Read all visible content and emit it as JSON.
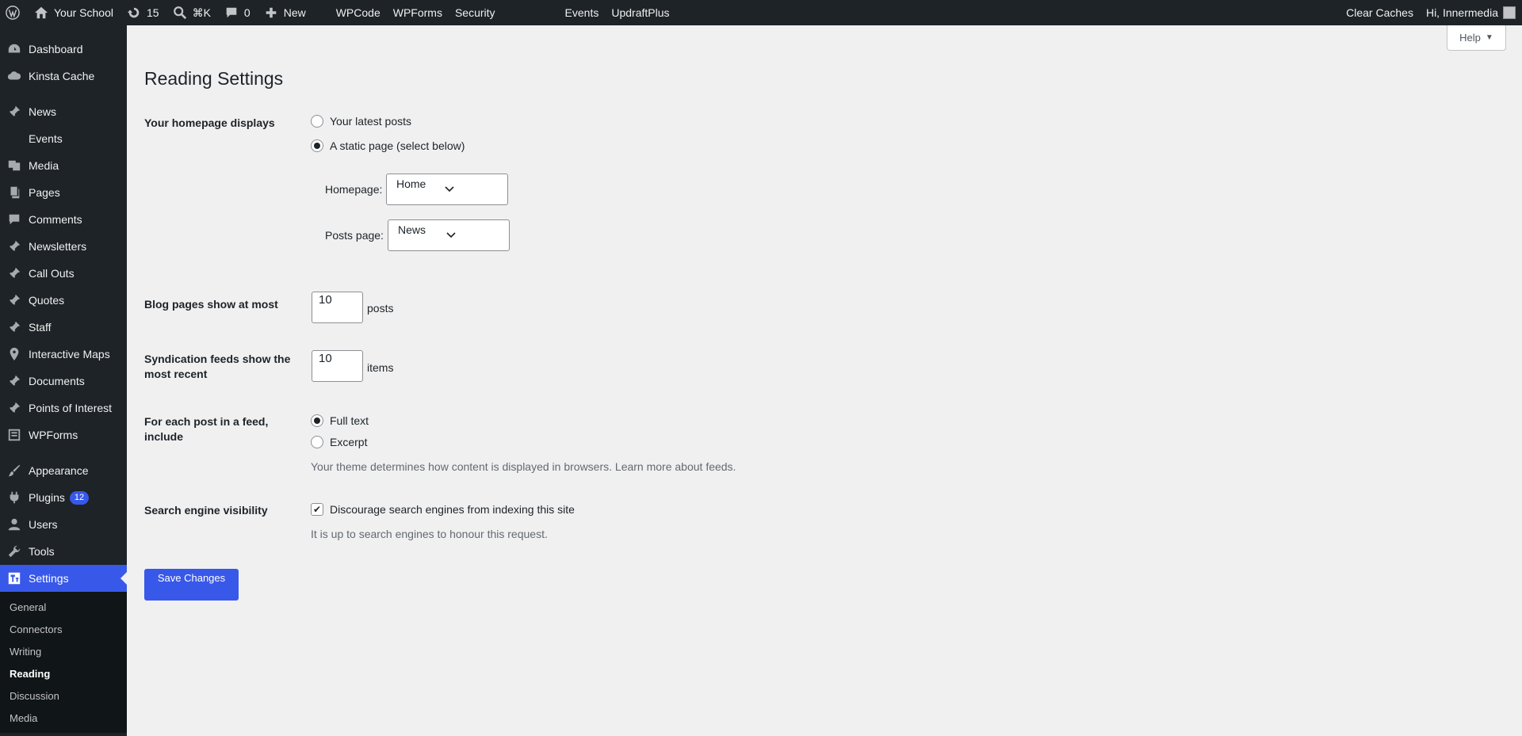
{
  "adminbar": {
    "site_name": "Your School",
    "updates_count": "15",
    "search_shortcut": "⌘K",
    "comments_count": "0",
    "new_label": "New",
    "links": [
      "WPCode",
      "WPForms",
      "Security",
      "Events",
      "UpdraftPlus"
    ],
    "clear_caches": "Clear Caches",
    "greeting": "Hi, Innermedia"
  },
  "sidebar": {
    "items": [
      {
        "label": "Dashboard",
        "icon": "dashboard-icon"
      },
      {
        "label": "Kinsta Cache",
        "icon": "cloud-icon"
      },
      {
        "label": "News",
        "icon": "pin-icon"
      },
      {
        "label": "Events",
        "icon": "blank-icon"
      },
      {
        "label": "Media",
        "icon": "media-icon"
      },
      {
        "label": "Pages",
        "icon": "pages-icon"
      },
      {
        "label": "Comments",
        "icon": "comment-icon"
      },
      {
        "label": "Newsletters",
        "icon": "pin-icon"
      },
      {
        "label": "Call Outs",
        "icon": "pin-icon"
      },
      {
        "label": "Quotes",
        "icon": "pin-icon"
      },
      {
        "label": "Staff",
        "icon": "pin-icon"
      },
      {
        "label": "Interactive Maps",
        "icon": "location-icon"
      },
      {
        "label": "Documents",
        "icon": "pin-icon"
      },
      {
        "label": "Points of Interest",
        "icon": "pin-icon"
      },
      {
        "label": "WPForms",
        "icon": "forms-icon"
      },
      {
        "label": "Appearance",
        "icon": "brush-icon"
      },
      {
        "label": "Plugins",
        "icon": "plugin-icon",
        "badge": "12"
      },
      {
        "label": "Users",
        "icon": "user-icon"
      },
      {
        "label": "Tools",
        "icon": "wrench-icon"
      },
      {
        "label": "Settings",
        "icon": "settings-icon"
      }
    ],
    "submenu": [
      "General",
      "Connectors",
      "Writing",
      "Reading",
      "Discussion",
      "Media"
    ]
  },
  "help": {
    "label": "Help",
    "caret": "▼"
  },
  "page": {
    "title": "Reading Settings",
    "homepage_displays": {
      "label": "Your homepage displays",
      "option_latest": "Your latest posts",
      "option_static": "A static page (select below)",
      "selected": "A static page (select below)",
      "homepage_label": "Homepage:",
      "homepage_value": "Home",
      "posts_page_label": "Posts page:",
      "posts_page_value": "News"
    },
    "blog_pages": {
      "label": "Blog pages show at most",
      "value": "10",
      "unit": "posts"
    },
    "syndication": {
      "label_line1": "Syndication feeds show the",
      "label_line2": "most recent",
      "value": "10",
      "unit": "items"
    },
    "feed_include": {
      "label_line1": "For each post in a feed,",
      "label_line2": "include",
      "option_full": "Full text",
      "option_excerpt": "Excerpt",
      "selected": "Full text",
      "description": "Your theme determines how content is displayed in browsers. Learn more about feeds."
    },
    "search_visibility": {
      "label": "Search engine visibility",
      "checkbox_label": "Discourage search engines from indexing this site",
      "checked": true,
      "description": "It is up to search engines to honour this request."
    },
    "save_button": "Save Changes"
  },
  "colors": {
    "accent": "#3858e9",
    "bar": "#1d2327",
    "background": "#f0f0f1"
  }
}
